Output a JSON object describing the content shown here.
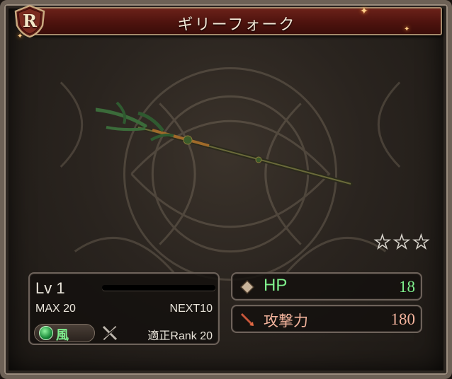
{
  "rarity": {
    "letter": "R",
    "icon": "rarity-r-icon"
  },
  "weapon": {
    "name": "ギリーフォーク",
    "art_icon": "trident-spear-icon"
  },
  "stars": {
    "count": 3,
    "filled": 0,
    "glyph": "★"
  },
  "level": {
    "lv_label": "Lv 1",
    "max_label": "MAX 20",
    "next_label": "NEXT10",
    "exp_fraction": 0.0
  },
  "element": {
    "label": "風",
    "icon": "wind-element-icon",
    "color": "#7fef8f"
  },
  "skill": {
    "icon": "crossed-swords-disabled-icon"
  },
  "rank": {
    "label": "適正Rank 20"
  },
  "stats": {
    "hp": {
      "label": "HP",
      "value": "18",
      "icon": "diamond-icon",
      "color": "#7ef08c"
    },
    "attack": {
      "label": "攻撃力",
      "value": "180",
      "icon": "spear-attack-icon",
      "color": "#f3b39c"
    }
  }
}
